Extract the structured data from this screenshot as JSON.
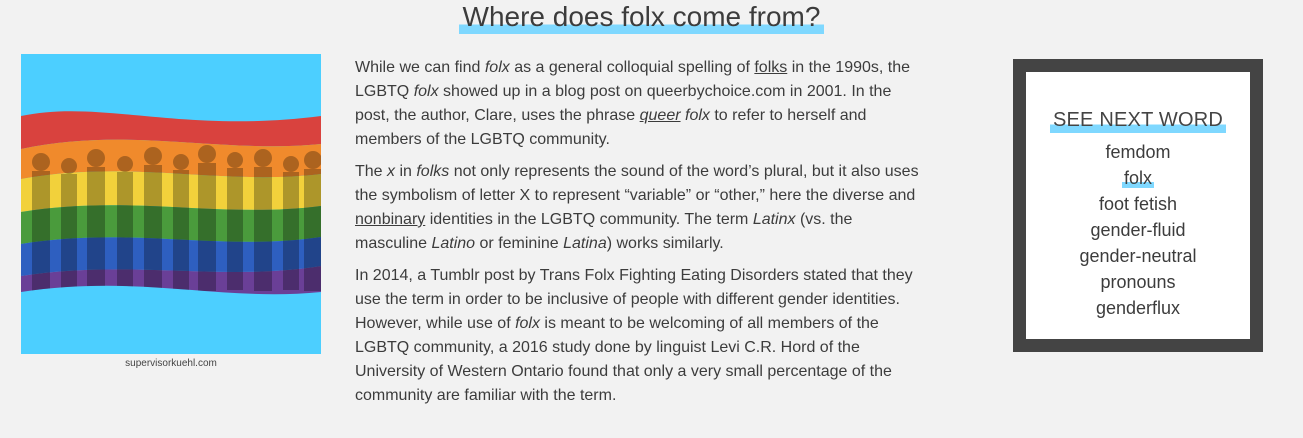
{
  "section_title": "Where does folx come from?",
  "image_caption": "supervisorkuehl.com",
  "article": {
    "p1": {
      "t1": "While we can find ",
      "em1": "folx",
      "t2": " as a general colloquial spelling of ",
      "link1": "folks",
      "t3": " in the 1990s, the LGBTQ ",
      "em2": "folx",
      "t4": " showed up in a blog post on queerbychoice.com in 2001. In the post, the author, Clare, uses the phrase ",
      "link2": "queer",
      "t5": " ",
      "em3": "folx",
      "t6": " to refer to herself and members of the LGBTQ community."
    },
    "p2": {
      "t1": "The ",
      "em1": "x",
      "t2": " in ",
      "em2": "folks",
      "t3": " not only represents the sound of the word’s plural, but it also uses the symbolism of letter X to represent “variable” or “other,” here the diverse and ",
      "link1": "nonbinary",
      "t4": " identities in the LGBTQ community. The term ",
      "em3": "Latinx",
      "t5": " (vs. the masculine ",
      "em4": "Latino",
      "t6": " or feminine ",
      "em5": "Latina",
      "t7": ") works similarly."
    },
    "p3": {
      "t1": "In 2014, a Tumblr post by Trans Folx Fighting Eating Disorders stated that they use the term in order to be inclusive of people with different gender identities. However, while use of ",
      "em1": "folx",
      "t2": " is meant to be welcoming of all members of the LGBTQ community, a 2016 study done by linguist Levi C.R. Hord of the University of Western Ontario found that only a very small percentage of the community are familiar with the term."
    }
  },
  "sidebar": {
    "title": "SEE NEXT WORD",
    "words": [
      "femdom",
      "folx",
      "foot fetish",
      "gender-fluid",
      "gender-neutral",
      "pronouns",
      "genderflux"
    ],
    "current_index": 1
  },
  "colors": {
    "highlight": "#7fd8ff",
    "image_background": "#4ccfff",
    "sidebar_frame": "#444444",
    "page_background": "#f2f2f2"
  }
}
